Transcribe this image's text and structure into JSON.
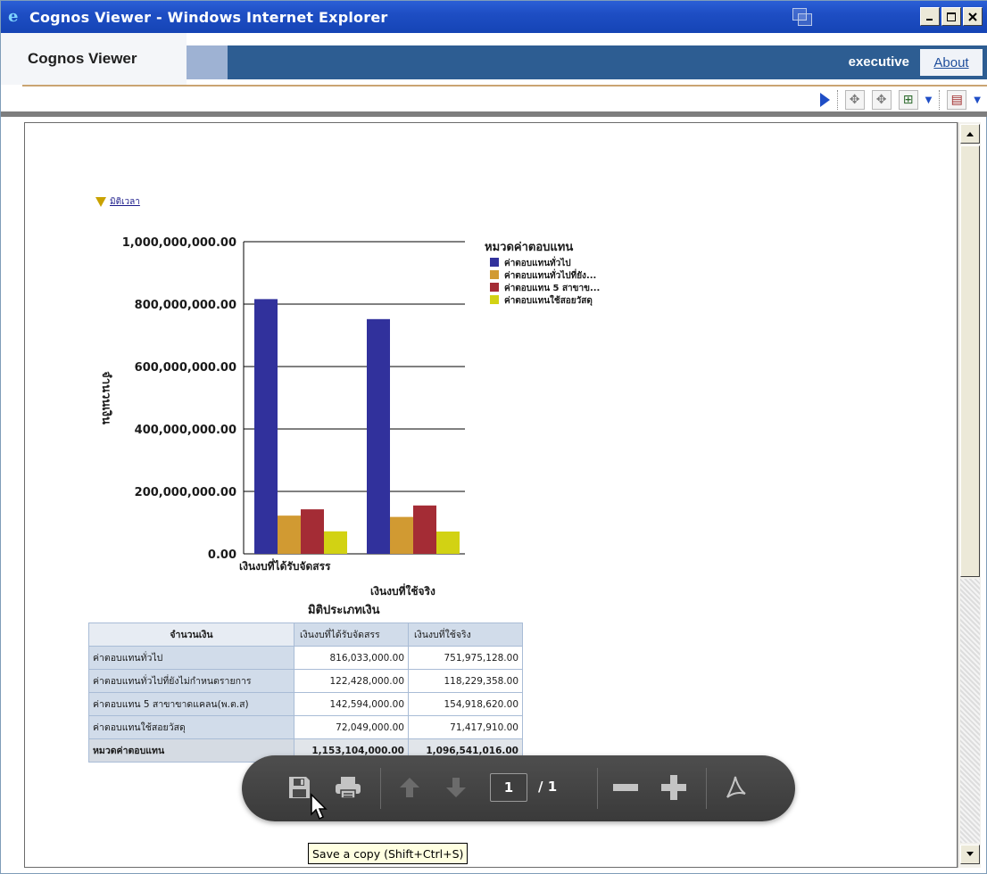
{
  "window": {
    "title": "Cognos Viewer - Windows Internet Explorer",
    "controls": [
      "minimize",
      "maximize",
      "close"
    ]
  },
  "app": {
    "title": "Cognos Viewer",
    "user": "executive",
    "about": "About",
    "accent_color": "#2d5d92"
  },
  "toolbar": {
    "items": [
      "run-icon",
      "drill-down-icon",
      "drill-up-icon",
      "go-to-icon",
      "view-icon"
    ]
  },
  "report": {
    "filter_label": "มิติเวลา"
  },
  "chart_data": {
    "type": "bar",
    "ylabel": "จำนวนเงิน",
    "xlabel": "มิติประเภทเงิน",
    "ylim": [
      0,
      1000000000
    ],
    "yticks": [
      "1,000,000,000.00",
      "800,000,000.00",
      "600,000,000.00",
      "400,000,000.00",
      "200,000,000.00",
      "0.00"
    ],
    "grid": true,
    "legend_title": "หมวดค่าตอบแทน",
    "legend_placement": "top-right",
    "categories": [
      "เงินงบที่ได้รับจัดสรร",
      "เงินงบที่ใช้จริง"
    ],
    "series": [
      {
        "name": "ค่าตอบแทนทั่วไป",
        "color": "#31319c",
        "values": [
          816033000,
          751975128
        ]
      },
      {
        "name": "ค่าตอบแทนทั่วไปที่ยัง...",
        "color": "#d19a32",
        "values": [
          122428000,
          118229358
        ]
      },
      {
        "name": "ค่าตอบแทน 5 สาขาข...",
        "color": "#a42c35",
        "values": [
          142594000,
          154918620
        ]
      },
      {
        "name": "ค่าตอบแทนใช้สอยวัสดุ",
        "color": "#d2d213",
        "values": [
          72049000,
          71417910
        ]
      }
    ]
  },
  "crosstab": {
    "corner": "จำนวนเงิน",
    "columns": [
      "เงินงบที่ได้รับจัดสรร",
      "เงินงบที่ใช้จริง"
    ],
    "rows": [
      {
        "label": "ค่าตอบแทนทั่วไป",
        "v1": "816,033,000.00",
        "v2": "751,975,128.00"
      },
      {
        "label": "ค่าตอบแทนทั่วไปที่ยังไม่กำหนดรายการ",
        "v1": "122,428,000.00",
        "v2": "118,229,358.00"
      },
      {
        "label": "ค่าตอบแทน 5 สาขาขาดแคลน(พ.ต.ส)",
        "v1": "142,594,000.00",
        "v2": "154,918,620.00"
      },
      {
        "label": "ค่าตอบแทนใช้สอยวัสดุ",
        "v1": "72,049,000.00",
        "v2": "71,417,910.00"
      }
    ],
    "total": {
      "label": "หมวดค่าตอบแทน",
      "v1": "1,153,104,000.00",
      "v2": "1,096,541,016.00"
    }
  },
  "pager": {
    "current_page": "1",
    "of_text": "/ 1",
    "tooltip": "Save a copy (Shift+Ctrl+S)"
  }
}
